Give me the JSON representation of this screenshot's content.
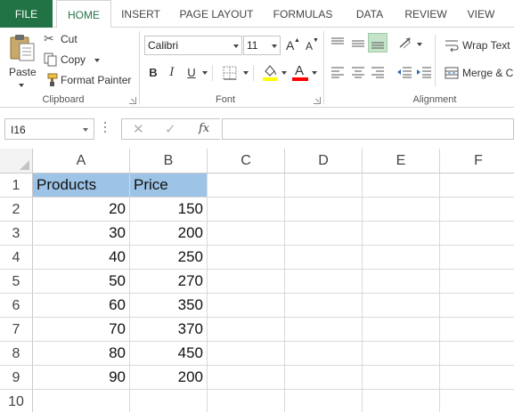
{
  "tabs": [
    {
      "label": "FILE",
      "active": false,
      "name": "tab-file"
    },
    {
      "label": "HOME",
      "active": true,
      "name": "tab-home"
    },
    {
      "label": "INSERT",
      "active": false,
      "name": "tab-insert"
    },
    {
      "label": "PAGE LAYOUT",
      "active": false,
      "name": "tab-page-layout"
    },
    {
      "label": "FORMULAS",
      "active": false,
      "name": "tab-formulas"
    },
    {
      "label": "DATA",
      "active": false,
      "name": "tab-data"
    },
    {
      "label": "REVIEW",
      "active": false,
      "name": "tab-review"
    },
    {
      "label": "VIEW",
      "active": false,
      "name": "tab-view"
    }
  ],
  "ribbon": {
    "clipboard": {
      "label": "Clipboard",
      "paste": "Paste",
      "cut": "Cut",
      "copy": "Copy",
      "format_painter": "Format Painter"
    },
    "font": {
      "label": "Font",
      "font_name": "Calibri",
      "font_size": "11",
      "bold": "B",
      "italic": "I",
      "underline": "U",
      "grow": "A",
      "shrink": "A",
      "font_color": "A"
    },
    "alignment": {
      "label": "Alignment",
      "wrap_text": "Wrap Text",
      "merge": "Merge & C"
    }
  },
  "formula_bar": {
    "name_box": "I16",
    "cancel": "✕",
    "enter": "✓",
    "fx": "fx",
    "formula": ""
  },
  "sheet": {
    "columns": [
      "A",
      "B",
      "C",
      "D",
      "E",
      "F"
    ],
    "rows": [
      "1",
      "2",
      "3",
      "4",
      "5",
      "6",
      "7",
      "8",
      "9",
      "10"
    ],
    "header_fill": "#9dc3e6",
    "cells": [
      [
        "Products",
        "Price"
      ],
      [
        "20",
        "150"
      ],
      [
        "30",
        "200"
      ],
      [
        "40",
        "250"
      ],
      [
        "50",
        "270"
      ],
      [
        "60",
        "350"
      ],
      [
        "70",
        "370"
      ],
      [
        "80",
        "450"
      ],
      [
        "90",
        "200"
      ]
    ]
  },
  "colors": {
    "file_tab": "#217346",
    "active_tab_text": "#217346",
    "font_color_underline": "#ff0000",
    "fill_color_underline": "#ffff00"
  }
}
